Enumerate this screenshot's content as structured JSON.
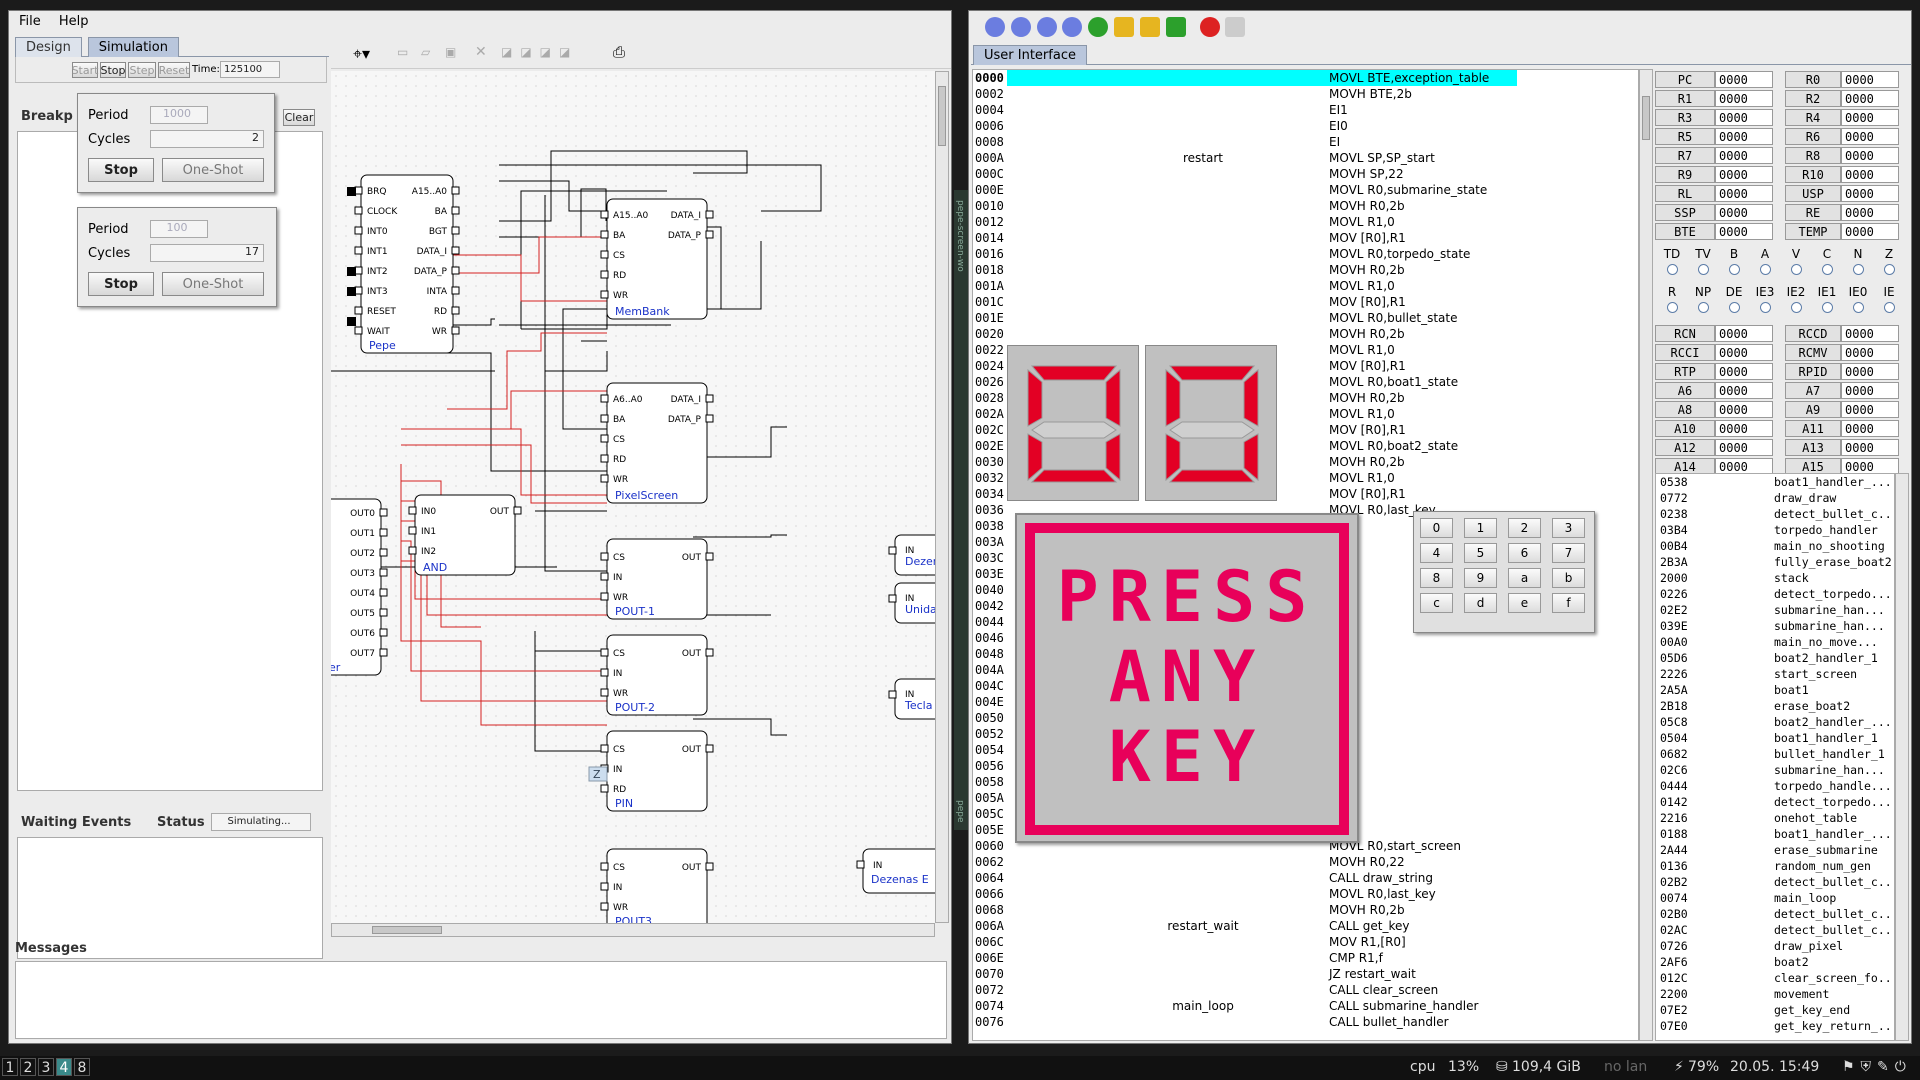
{
  "menu": {
    "file": "File",
    "help": "Help"
  },
  "left_tabs": {
    "design": "Design",
    "simulation": "Simulation"
  },
  "sim_controls": {
    "start": "Start",
    "stop": "Stop",
    "step": "Step",
    "reset": "Reset",
    "time_label": "Time:",
    "time_value": "125100"
  },
  "breakpoints": {
    "label": "Breakp",
    "clear": "Clear"
  },
  "clock1": {
    "period_label": "Period",
    "period_value": "1000",
    "cycles_label": "Cycles",
    "cycles_value": "2",
    "stop": "Stop",
    "oneshot": "One-Shot"
  },
  "clock2": {
    "period_label": "Period",
    "period_value": "100",
    "cycles_label": "Cycles",
    "cycles_value": "17",
    "stop": "Stop",
    "oneshot": "One-Shot"
  },
  "events": {
    "waiting": "Waiting Events",
    "status_label": "Status",
    "status_value": "Simulating..."
  },
  "messages_label": "Messages",
  "circuit": {
    "pepe": {
      "name": "Pepe",
      "left": [
        "BRQ",
        "CLOCK",
        "INT0",
        "INT1",
        "INT2",
        "INT3",
        "RESET",
        "WAIT"
      ],
      "right": [
        "A15..A0",
        "BA",
        "BGT",
        "DATA_I",
        "DATA_P",
        "INTA",
        "RD",
        "WR"
      ]
    },
    "membank": {
      "name": "MemBank",
      "left": [
        "A15..A0",
        "BA",
        "CS",
        "RD",
        "WR"
      ],
      "right": [
        "DATA_I",
        "DATA_P"
      ]
    },
    "pixelscreen": {
      "name": "PixelScreen",
      "left": [
        "A6..A0",
        "BA",
        "CS",
        "RD",
        "WR"
      ],
      "right": [
        "DATA_I",
        "DATA_P"
      ]
    },
    "pout1": {
      "name": "POUT-1",
      "left": [
        "CS",
        "IN",
        "WR"
      ],
      "right": [
        "OUT"
      ]
    },
    "pout2": {
      "name": "POUT-2",
      "left": [
        "CS",
        "IN",
        "WR"
      ],
      "right": [
        "OUT"
      ]
    },
    "pin": {
      "name": "PIN",
      "left": [
        "CS",
        "IN",
        "RD"
      ],
      "right": [
        "OUT"
      ]
    },
    "pout3": {
      "name": "POUT3",
      "left": [
        "CS",
        "IN",
        "WR"
      ],
      "right": [
        "OUT"
      ]
    },
    "and": {
      "name": "AND",
      "left": [
        "IN0",
        "IN1",
        "IN2"
      ],
      "right": [
        "OUT"
      ]
    },
    "decoder": {
      "outs": [
        "OUT0",
        "OUT1",
        "OUT2",
        "OUT3",
        "OUT4",
        "OUT5",
        "OUT6",
        "OUT7"
      ],
      "name": "er"
    },
    "dezenas": {
      "in": "IN",
      "name": "Dezen"
    },
    "unidades": {
      "in": "IN",
      "name": "Unida"
    },
    "teclado": {
      "in": "IN",
      "name": "Tecla"
    },
    "dezenas_e": {
      "in": "IN",
      "name": "Dezenas E"
    },
    "zlabel": "Z"
  },
  "right_tab": "User Interface",
  "vertical_labels": {
    "a": "pepe-screen-wo",
    "b": "UI-wd-pepe"
  },
  "code_rows": [
    {
      "addr": "0000",
      "label": "",
      "instr": "MOVL BTE,exception_table"
    },
    {
      "addr": "0002",
      "label": "",
      "instr": "MOVH BTE,2b"
    },
    {
      "addr": "0004",
      "label": "",
      "instr": "EI1"
    },
    {
      "addr": "0006",
      "label": "",
      "instr": "EI0"
    },
    {
      "addr": "0008",
      "label": "",
      "instr": "EI"
    },
    {
      "addr": "000A",
      "label": "restart",
      "instr": "MOVL SP,SP_start"
    },
    {
      "addr": "000C",
      "label": "",
      "instr": "MOVH SP,22"
    },
    {
      "addr": "000E",
      "label": "",
      "instr": "MOVL R0,submarine_state"
    },
    {
      "addr": "0010",
      "label": "",
      "instr": "MOVH R0,2b"
    },
    {
      "addr": "0012",
      "label": "",
      "instr": "MOVL R1,0"
    },
    {
      "addr": "0014",
      "label": "",
      "instr": "MOV [R0],R1"
    },
    {
      "addr": "0016",
      "label": "",
      "instr": "MOVL R0,torpedo_state"
    },
    {
      "addr": "0018",
      "label": "",
      "instr": "MOVH R0,2b"
    },
    {
      "addr": "001A",
      "label": "",
      "instr": "MOVL R1,0"
    },
    {
      "addr": "001C",
      "label": "",
      "instr": "MOV [R0],R1"
    },
    {
      "addr": "001E",
      "label": "",
      "instr": "MOVL R0,bullet_state"
    },
    {
      "addr": "0020",
      "label": "",
      "instr": "MOVH R0,2b"
    },
    {
      "addr": "0022",
      "label": "",
      "instr": "MOVL R1,0"
    },
    {
      "addr": "0024",
      "label": "",
      "instr": "MOV [R0],R1"
    },
    {
      "addr": "0026",
      "label": "",
      "instr": "MOVL R0,boat1_state"
    },
    {
      "addr": "0028",
      "label": "",
      "instr": "MOVH R0,2b"
    },
    {
      "addr": "002A",
      "label": "",
      "instr": "MOVL R1,0"
    },
    {
      "addr": "002C",
      "label": "",
      "instr": "MOV [R0],R1"
    },
    {
      "addr": "002E",
      "label": "",
      "instr": "MOVL R0,boat2_state"
    },
    {
      "addr": "0030",
      "label": "",
      "instr": "MOVH R0,2b"
    },
    {
      "addr": "0032",
      "label": "",
      "instr": "MOVL R1,0"
    },
    {
      "addr": "0034",
      "label": "",
      "instr": "MOV [R0],R1"
    },
    {
      "addr": "0036",
      "label": "",
      "instr": "MOVL R0,last_key"
    },
    {
      "addr": "0038",
      "label": "",
      "instr": "b"
    },
    {
      "addr": "003A",
      "label": "",
      "instr": ""
    },
    {
      "addr": "003C",
      "label": "",
      "instr": "co"
    },
    {
      "addr": "003E",
      "label": "",
      "instr": "b"
    },
    {
      "addr": "0040",
      "label": "",
      "instr": ""
    },
    {
      "addr": "0042",
      "label": "",
      "instr": "b"
    },
    {
      "addr": "0044",
      "label": "",
      "instr": ""
    },
    {
      "addr": "0046",
      "label": "",
      "instr": "0"
    },
    {
      "addr": "0048",
      "label": "",
      "instr": "R1"
    },
    {
      "addr": "004A",
      "label": "",
      "instr": ""
    },
    {
      "addr": "004C",
      "label": "",
      "instr": ""
    },
    {
      "addr": "004E",
      "label": "",
      "instr": ""
    },
    {
      "addr": "0050",
      "label": "",
      "instr": ""
    },
    {
      "addr": "0052",
      "label": "",
      "instr": ""
    },
    {
      "addr": "0054",
      "label": "",
      "instr": ""
    },
    {
      "addr": "0056",
      "label": "",
      "instr": ""
    },
    {
      "addr": "0058",
      "label": "",
      "instr": ""
    },
    {
      "addr": "005A",
      "label": "",
      "instr": ""
    },
    {
      "addr": "005C",
      "label": "",
      "instr": ""
    },
    {
      "addr": "005E",
      "label": "",
      "instr": ""
    },
    {
      "addr": "0060",
      "label": "",
      "instr": "MOVL R0,start_screen"
    },
    {
      "addr": "0062",
      "label": "",
      "instr": "MOVH R0,22"
    },
    {
      "addr": "0064",
      "label": "",
      "instr": "CALL draw_string"
    },
    {
      "addr": "0066",
      "label": "",
      "instr": "MOVL R0,last_key"
    },
    {
      "addr": "0068",
      "label": "",
      "instr": "MOVH R0,2b"
    },
    {
      "addr": "006A",
      "label": "restart_wait",
      "instr": "CALL get_key"
    },
    {
      "addr": "006C",
      "label": "",
      "instr": "MOV R1,[R0]"
    },
    {
      "addr": "006E",
      "label": "",
      "instr": "CMP R1,f"
    },
    {
      "addr": "0070",
      "label": "",
      "instr": "JZ restart_wait"
    },
    {
      "addr": "0072",
      "label": "",
      "instr": "CALL clear_screen"
    },
    {
      "addr": "0074",
      "label": "main_loop",
      "instr": "CALL submarine_handler"
    },
    {
      "addr": "0076",
      "label": "",
      "instr": "CALL bullet_handler"
    }
  ],
  "registers": [
    [
      "PC",
      "0000",
      "R0",
      "0000"
    ],
    [
      "R1",
      "0000",
      "R2",
      "0000"
    ],
    [
      "R3",
      "0000",
      "R4",
      "0000"
    ],
    [
      "R5",
      "0000",
      "R6",
      "0000"
    ],
    [
      "R7",
      "0000",
      "R8",
      "0000"
    ],
    [
      "R9",
      "0000",
      "R10",
      "0000"
    ],
    [
      "RL",
      "0000",
      "USP",
      "0000"
    ],
    [
      "SSP",
      "0000",
      "RE",
      "0000"
    ],
    [
      "BTE",
      "0000",
      "TEMP",
      "0000"
    ]
  ],
  "flags_row1": [
    "TD",
    "TV",
    "B",
    "A",
    "V",
    "C",
    "N",
    "Z"
  ],
  "flags_row2": [
    "R",
    "NP",
    "DE",
    "IE3",
    "IE2",
    "IE1",
    "IE0",
    "IE"
  ],
  "registers2": [
    [
      "RCN",
      "0000",
      "RCCD",
      "0000"
    ],
    [
      "RCCI",
      "0000",
      "RCMV",
      "0000"
    ],
    [
      "RTP",
      "0000",
      "RPID",
      "0000"
    ],
    [
      "A6",
      "0000",
      "A7",
      "0000"
    ],
    [
      "A8",
      "0000",
      "A9",
      "0000"
    ],
    [
      "A10",
      "0000",
      "A11",
      "0000"
    ],
    [
      "A12",
      "0000",
      "A13",
      "0000"
    ],
    [
      "A14",
      "0000",
      "A15",
      "0000"
    ]
  ],
  "symbols": [
    [
      "0538",
      "boat1_handler_..."
    ],
    [
      "0772",
      "draw_draw"
    ],
    [
      "0238",
      "detect_bullet_c..."
    ],
    [
      "03B4",
      "torpedo_handler"
    ],
    [
      "00B4",
      "main_no_shooting"
    ],
    [
      "2B3A",
      "fully_erase_boat2"
    ],
    [
      "2000",
      "stack"
    ],
    [
      "0226",
      "detect_torpedo..."
    ],
    [
      "02E2",
      "submarine_han..."
    ],
    [
      "039E",
      "submarine_han..."
    ],
    [
      "00A0",
      "main_no_move..."
    ],
    [
      "05D6",
      "boat2_handler_1"
    ],
    [
      "2226",
      "start_screen"
    ],
    [
      "2A5A",
      "boat1"
    ],
    [
      "2B18",
      "erase_boat2"
    ],
    [
      "05C8",
      "boat2_handler_..."
    ],
    [
      "0504",
      "boat1_handler_1"
    ],
    [
      "0682",
      "bullet_handler_1"
    ],
    [
      "02C6",
      "submarine_han..."
    ],
    [
      "0444",
      "torpedo_handle..."
    ],
    [
      "0142",
      "detect_torpedo..."
    ],
    [
      "2216",
      "onehot_table"
    ],
    [
      "0188",
      "boat1_handler_..."
    ],
    [
      "2A44",
      "erase_submarine"
    ],
    [
      "0136",
      "random_num_gen"
    ],
    [
      "02B2",
      "detect_bullet_c..."
    ],
    [
      "0074",
      "main_loop"
    ],
    [
      "02B0",
      "detect_bullet_c..."
    ],
    [
      "02AC",
      "detect_bullet_c..."
    ],
    [
      "0726",
      "draw_pixel"
    ],
    [
      "2AF6",
      "boat2"
    ],
    [
      "012C",
      "clear_screen_fo..."
    ],
    [
      "2200",
      "movement"
    ],
    [
      "07E2",
      "get_key_end"
    ],
    [
      "07E0",
      "get_key_return_..."
    ]
  ],
  "display_digits": [
    "0",
    "0"
  ],
  "press_text": [
    "PRESS",
    "ANY",
    "KEY"
  ],
  "keypad": [
    "0",
    "1",
    "2",
    "3",
    "4",
    "5",
    "6",
    "7",
    "8",
    "9",
    "a",
    "b",
    "c",
    "d",
    "e",
    "f"
  ],
  "taskbar": {
    "workspaces": [
      "1",
      "2",
      "3",
      "4",
      "8"
    ],
    "active_workspace": "4",
    "cpu_label": "cpu",
    "cpu_value": "13%",
    "disk": "109,4 GiB",
    "lan": "no lan",
    "battery": "79%",
    "datetime": "20.05. 15:49"
  },
  "colors": {
    "highlight": "#00ffff",
    "wire_red": "#d42020",
    "seg_red": "#e30024",
    "accent_blue": "#1a32c8"
  }
}
